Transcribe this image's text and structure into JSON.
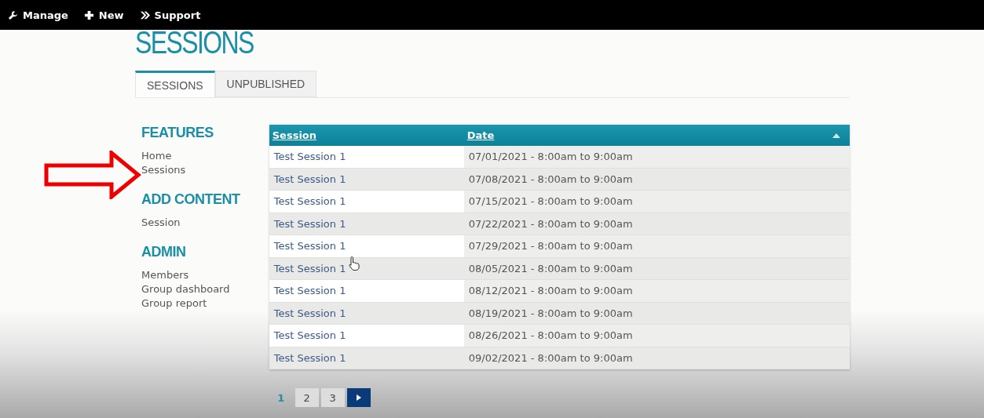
{
  "toolbar": {
    "items": [
      {
        "label": "Manage",
        "kind": "wrench"
      },
      {
        "label": "New",
        "kind": "plus"
      },
      {
        "label": "Support",
        "kind": "chevrons"
      }
    ]
  },
  "page_title": "SESSIONS",
  "tabs": [
    {
      "label": "SESSIONS",
      "selected": true
    },
    {
      "label": "UNPUBLISHED",
      "selected": false
    }
  ],
  "sidebar": {
    "sections": [
      {
        "heading": "FEATURES",
        "items": [
          "Home",
          "Sessions"
        ]
      },
      {
        "heading": "ADD CONTENT",
        "items": [
          "Session"
        ]
      },
      {
        "heading": "ADMIN",
        "items": [
          "Members",
          "Group dashboard",
          "Group report"
        ]
      }
    ]
  },
  "table": {
    "columns": [
      "Session",
      "Date"
    ],
    "rows": [
      [
        "Test Session 1",
        "07/01/2021 - 8:00am to 9:00am"
      ],
      [
        "Test Session 1",
        "07/08/2021 - 8:00am to 9:00am"
      ],
      [
        "Test Session 1",
        "07/15/2021 - 8:00am to 9:00am"
      ],
      [
        "Test Session 1",
        "07/22/2021 - 8:00am to 9:00am"
      ],
      [
        "Test Session 1",
        "07/29/2021 - 8:00am to 9:00am"
      ],
      [
        "Test Session 1",
        "08/05/2021 - 8:00am to 9:00am"
      ],
      [
        "Test Session 1",
        "08/12/2021 - 8:00am to 9:00am"
      ],
      [
        "Test Session 1",
        "08/19/2021 - 8:00am to 9:00am"
      ],
      [
        "Test Session 1",
        "08/26/2021 - 8:00am to 9:00am"
      ],
      [
        "Test Session 1",
        "09/02/2021 - 8:00am to 9:00am"
      ]
    ]
  },
  "pagination": {
    "pages": [
      {
        "label": "1",
        "selected": true
      },
      {
        "label": "2",
        "selected": false
      },
      {
        "label": "3",
        "selected": false
      }
    ]
  }
}
